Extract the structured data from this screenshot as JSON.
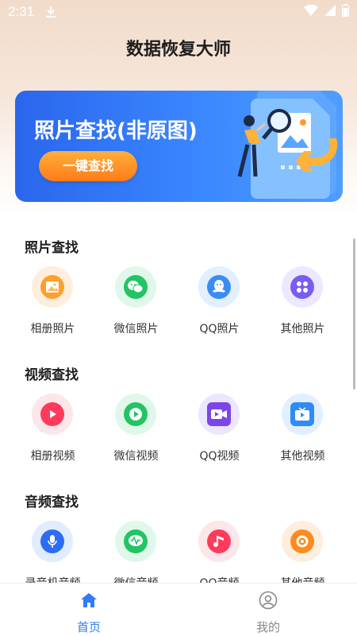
{
  "status": {
    "time": "2:31"
  },
  "app_title": "数据恢复大师",
  "banner": {
    "title": "照片查找(非原图)",
    "button": "一键查找"
  },
  "sections": [
    {
      "title": "照片查找",
      "items": [
        {
          "label": "相册照片",
          "icon": "image-icon",
          "bg": "#fdeedd",
          "fg": "#ff9f2d"
        },
        {
          "label": "微信照片",
          "icon": "wechat-icon",
          "bg": "#dff8ea",
          "fg": "#23c463"
        },
        {
          "label": "QQ照片",
          "icon": "qq-icon",
          "bg": "#e1efff",
          "fg": "#3b8cf5"
        },
        {
          "label": "其他照片",
          "icon": "grid-icon",
          "bg": "#ece8ff",
          "fg": "#7b5cf0"
        }
      ]
    },
    {
      "title": "视频查找",
      "items": [
        {
          "label": "相册视频",
          "icon": "play-icon",
          "bg": "#fde6ea",
          "fg": "#ff3b5c"
        },
        {
          "label": "微信视频",
          "icon": "wechat-play-icon",
          "bg": "#dff8ea",
          "fg": "#23c463"
        },
        {
          "label": "QQ视频",
          "icon": "video-camera-icon",
          "bg": "#ede6ff",
          "fg": "#7b45ea"
        },
        {
          "label": "其他视频",
          "icon": "tv-icon",
          "bg": "#e1efff",
          "fg": "#2f8cf5"
        }
      ]
    },
    {
      "title": "音频查找",
      "items": [
        {
          "label": "录音机音频",
          "icon": "microphone-icon",
          "bg": "#e1ecff",
          "fg": "#2f6cf5"
        },
        {
          "label": "微信音频",
          "icon": "waveform-icon",
          "bg": "#dff8ea",
          "fg": "#23c463"
        },
        {
          "label": "QQ音频",
          "icon": "music-note-icon",
          "bg": "#fde6ea",
          "fg": "#ff3b5c"
        },
        {
          "label": "其他音频",
          "icon": "record-icon",
          "bg": "#fdeedd",
          "fg": "#ff8a1e"
        }
      ]
    }
  ],
  "tabs": [
    {
      "label": "首页",
      "icon": "home-icon",
      "active": true
    },
    {
      "label": "我的",
      "icon": "profile-icon",
      "active": false
    }
  ],
  "colors": {
    "accent": "#2f7cf6",
    "inactive_tab": "#888888"
  }
}
